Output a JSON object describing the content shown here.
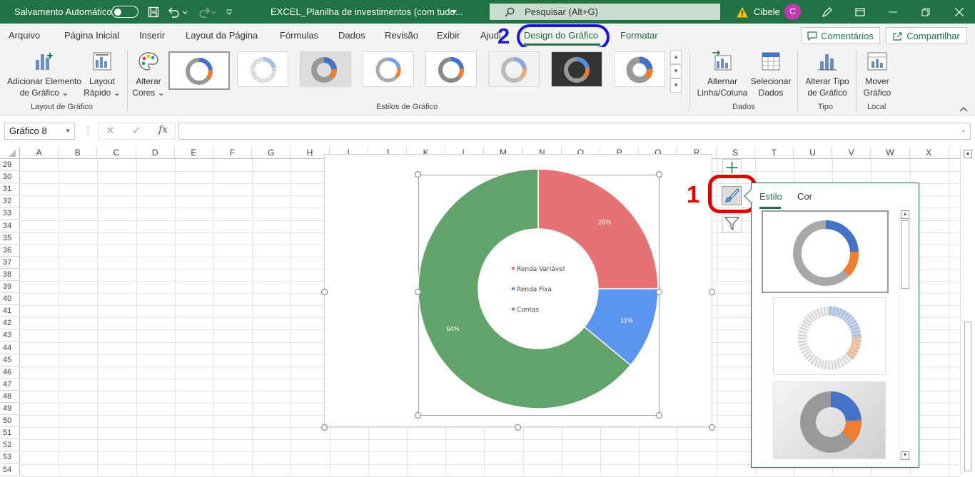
{
  "titlebar": {
    "autosave_label": "Salvamento Automático",
    "file_title": "EXCEL_Planilha de investimentos (com tudo...",
    "search_placeholder": "Pesquisar (Alt+G)",
    "user_name": "Cibele",
    "user_initial": "C"
  },
  "tabs": [
    {
      "label": "Arquivo"
    },
    {
      "label": "Página Inicial"
    },
    {
      "label": "Inserir"
    },
    {
      "label": "Layout da Página"
    },
    {
      "label": "Fórmulas"
    },
    {
      "label": "Dados"
    },
    {
      "label": "Revisão"
    },
    {
      "label": "Exibir"
    },
    {
      "label": "Ajuda"
    },
    {
      "label": "Design do Gráfico"
    },
    {
      "label": "Formatar"
    }
  ],
  "header_buttons": {
    "comments": "Comentários",
    "share": "Compartilhar"
  },
  "ribbon": {
    "add_element": [
      "Adicionar Elemento",
      "de Gráfico"
    ],
    "quick_layout": [
      "Layout",
      "Rápido"
    ],
    "change_colors": [
      "Alterar",
      "Cores"
    ],
    "switch_row_col": [
      "Alternar",
      "Linha/Coluna"
    ],
    "select_data": [
      "Selecionar",
      "Dados"
    ],
    "change_type": [
      "Alterar Tipo",
      "de Gráfico"
    ],
    "move_chart": [
      "Mover",
      "Gráfico"
    ],
    "groups": {
      "layout": "Layout de Gráfico",
      "styles": "Estilos de Gráfico",
      "data": "Dados",
      "type": "Tipo",
      "location": "Local"
    }
  },
  "namebox": "Gráfico 8",
  "columns": [
    "A",
    "B",
    "C",
    "D",
    "E",
    "F",
    "G",
    "H",
    "I",
    "J",
    "K",
    "L",
    "M",
    "N",
    "O",
    "P",
    "Q",
    "R",
    "S",
    "T",
    "U",
    "V",
    "W",
    "X"
  ],
  "rows": [
    "29",
    "30",
    "31",
    "32",
    "33",
    "34",
    "35",
    "36",
    "37",
    "38",
    "39",
    "40",
    "41",
    "42",
    "43",
    "44",
    "45",
    "46",
    "47",
    "48",
    "49",
    "50",
    "51",
    "52",
    "53",
    "54"
  ],
  "chart_data": {
    "type": "pie",
    "categories": [
      "Renda Variável",
      "Renda Fixa",
      "Contas"
    ],
    "values": [
      25,
      11,
      64
    ],
    "labels": [
      "25%",
      "11%",
      "64%"
    ],
    "colors": [
      "#e57373",
      "#5b95ee",
      "#62a36b"
    ],
    "legend_placement": "center"
  },
  "style_panel": {
    "tab_style": "Estilo",
    "tab_color": "Cor"
  },
  "annotations": {
    "step1": "1",
    "step2": "2"
  },
  "colors": {
    "accent": "#217346",
    "annotation_red": "#e00000",
    "annotation_blue": "#1a1adb"
  }
}
